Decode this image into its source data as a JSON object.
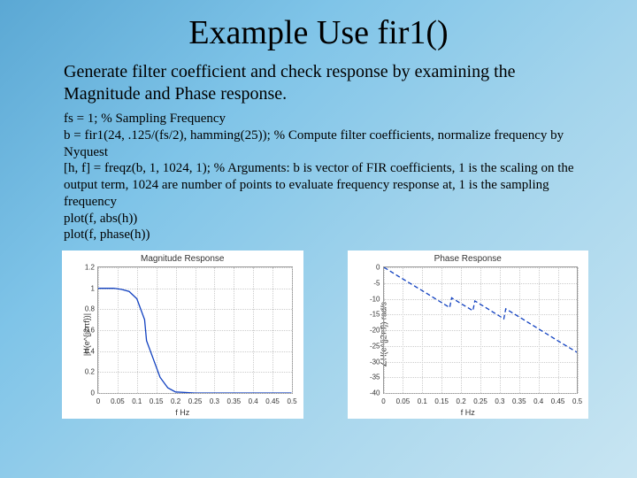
{
  "title": "Example Use fir1()",
  "description": "Generate filter coefficient and check response by examining the Magnitude and Phase response.",
  "code_lines": [
    "fs = 1;  % Sampling Frequency",
    "b = fir1(24, .125/(fs/2), hamming(25)); % Compute filter coefficients, normalize frequency by Nyquest",
    "[h, f] = freqz(b, 1, 1024, 1); % Arguments: b is vector of FIR coefficients, 1 is the scaling on the output term, 1024 are number of points to evaluate frequency response at, 1 is the sampling frequency",
    "plot(f, abs(h))",
    "plot(f, phase(h))"
  ],
  "chart_data": [
    {
      "type": "line",
      "title": "Magnitude Response",
      "xlabel": "f Hz",
      "ylabel": "|H(e^{j2πf})|",
      "xlim": [
        0,
        0.5
      ],
      "ylim": [
        0,
        1.2
      ],
      "xticks": [
        0,
        0.05,
        0.1,
        0.15,
        0.2,
        0.25,
        0.3,
        0.35,
        0.4,
        0.45,
        0.5
      ],
      "yticks": [
        0,
        0.2,
        0.4,
        0.6,
        0.8,
        1,
        1.2
      ],
      "x": [
        0,
        0.02,
        0.04,
        0.06,
        0.08,
        0.1,
        0.12,
        0.125,
        0.14,
        0.16,
        0.18,
        0.2,
        0.25,
        0.3,
        0.35,
        0.4,
        0.45,
        0.5
      ],
      "y": [
        1.0,
        1.0,
        1.0,
        0.99,
        0.97,
        0.9,
        0.7,
        0.5,
        0.35,
        0.15,
        0.05,
        0.01,
        0.0,
        0.0,
        0.0,
        0.0,
        0.0,
        0.0
      ]
    },
    {
      "type": "line",
      "title": "Phase Response",
      "xlabel": "f Hz",
      "ylabel": "∠H(e^{j2πf}) rad/s",
      "xlim": [
        0,
        0.5
      ],
      "ylim": [
        -40,
        0
      ],
      "xticks": [
        0,
        0.05,
        0.1,
        0.15,
        0.2,
        0.25,
        0.3,
        0.35,
        0.4,
        0.45,
        0.5
      ],
      "yticks": [
        -40,
        -35,
        -30,
        -25,
        -20,
        -15,
        -10,
        -5,
        0
      ],
      "x": [
        0,
        0.05,
        0.1,
        0.15,
        0.17,
        0.175,
        0.2,
        0.23,
        0.235,
        0.25,
        0.3,
        0.31,
        0.315,
        0.35,
        0.4,
        0.45,
        0.5
      ],
      "y": [
        0,
        -3.8,
        -7.5,
        -11.3,
        -12.8,
        -9.7,
        -11.6,
        -13.8,
        -10.7,
        -11.8,
        -15.6,
        -16.4,
        -13.2,
        -15.8,
        -19.6,
        -23.4,
        -27.1
      ]
    }
  ]
}
